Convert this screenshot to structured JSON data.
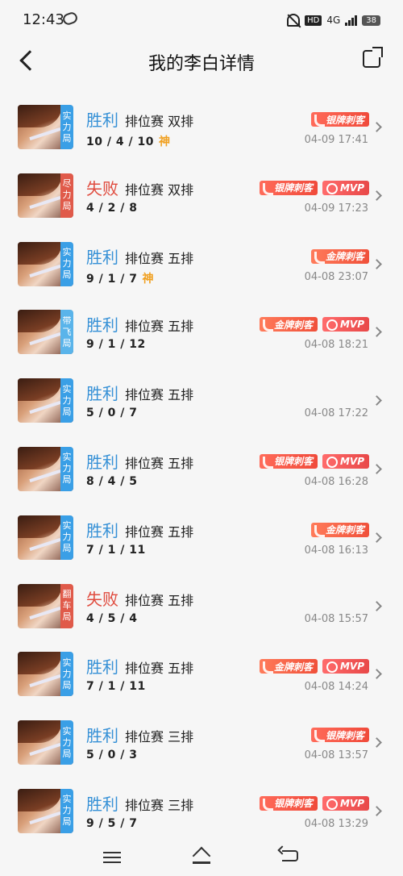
{
  "status_bar": {
    "time": "12:43",
    "hd": "HD",
    "network": "4G",
    "battery": "38"
  },
  "header": {
    "title": "我的李白详情"
  },
  "matches": [
    {
      "result": "胜利",
      "outcome": "win",
      "mode": "排位赛 双排",
      "kda": "10 / 4 / 10",
      "god": "神",
      "badge": "实力局",
      "badge_color": "blue",
      "tags": [
        "银牌刺客"
      ],
      "time": "04-09 17:41"
    },
    {
      "result": "失败",
      "outcome": "lose",
      "mode": "排位赛 双排",
      "kda": "4 / 2 / 8",
      "god": "",
      "badge": "尽力局",
      "badge_color": "red",
      "tags": [
        "银牌刺客",
        "MVP"
      ],
      "time": "04-09 17:23"
    },
    {
      "result": "胜利",
      "outcome": "win",
      "mode": "排位赛 五排",
      "kda": "9 / 1 / 7",
      "god": "神",
      "badge": "实力局",
      "badge_color": "blue",
      "tags": [
        "金牌刺客"
      ],
      "time": "04-08 23:07"
    },
    {
      "result": "胜利",
      "outcome": "win",
      "mode": "排位赛 五排",
      "kda": "9 / 1 / 12",
      "god": "",
      "badge": "带飞局",
      "badge_color": "sky",
      "tags": [
        "金牌刺客",
        "MVP"
      ],
      "time": "04-08 18:21"
    },
    {
      "result": "胜利",
      "outcome": "win",
      "mode": "排位赛 五排",
      "kda": "5 / 0 / 7",
      "god": "",
      "badge": "实力局",
      "badge_color": "blue",
      "tags": [],
      "time": "04-08 17:22"
    },
    {
      "result": "胜利",
      "outcome": "win",
      "mode": "排位赛 五排",
      "kda": "8 / 4 / 5",
      "god": "",
      "badge": "实力局",
      "badge_color": "blue",
      "tags": [
        "银牌刺客",
        "MVP"
      ],
      "time": "04-08 16:28"
    },
    {
      "result": "胜利",
      "outcome": "win",
      "mode": "排位赛 五排",
      "kda": "7 / 1 / 11",
      "god": "",
      "badge": "实力局",
      "badge_color": "blue",
      "tags": [
        "金牌刺客"
      ],
      "time": "04-08 16:13"
    },
    {
      "result": "失败",
      "outcome": "lose",
      "mode": "排位赛 五排",
      "kda": "4 / 5 / 4",
      "god": "",
      "badge": "翻车局",
      "badge_color": "red",
      "tags": [],
      "time": "04-08 15:57"
    },
    {
      "result": "胜利",
      "outcome": "win",
      "mode": "排位赛 五排",
      "kda": "7 / 1 / 11",
      "god": "",
      "badge": "实力局",
      "badge_color": "blue",
      "tags": [
        "金牌刺客",
        "MVP"
      ],
      "time": "04-08 14:24"
    },
    {
      "result": "胜利",
      "outcome": "win",
      "mode": "排位赛 三排",
      "kda": "5 / 0 / 3",
      "god": "",
      "badge": "实力局",
      "badge_color": "blue",
      "tags": [
        "银牌刺客"
      ],
      "time": "04-08 13:57"
    },
    {
      "result": "胜利",
      "outcome": "win",
      "mode": "排位赛 三排",
      "kda": "9 / 5 / 7",
      "god": "",
      "badge": "实力局",
      "badge_color": "blue",
      "tags": [
        "银牌刺客",
        "MVP"
      ],
      "time": "04-08 13:29"
    }
  ]
}
